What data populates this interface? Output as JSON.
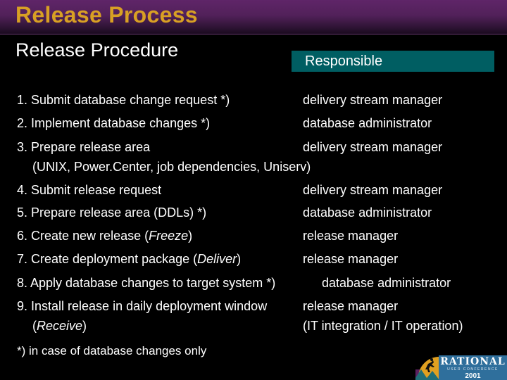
{
  "slide": {
    "title": "Release Process",
    "subtitle": "Release Procedure",
    "responsible_header": "Responsible",
    "rows": [
      {
        "step": "1. Submit database change request *)",
        "responsible": "delivery stream manager"
      },
      {
        "step": "2. Implement database changes *)",
        "responsible": "database administrator"
      },
      {
        "step": "3. Prepare release area",
        "step_detail": "(UNIX, Power.Center, job dependencies, Uniserv)",
        "responsible": "delivery stream manager"
      },
      {
        "step": "4. Submit release request",
        "responsible": "delivery stream manager"
      },
      {
        "step": "5. Prepare release area (DDLs) *)",
        "responsible": "database administrator"
      },
      {
        "step_prefix": "6. Create new release (",
        "step_italic": "Freeze",
        "step_suffix": ")",
        "responsible": "release manager"
      },
      {
        "step_prefix": "7. Create deployment package (",
        "step_italic": "Deliver",
        "step_suffix": ")",
        "responsible": "release manager"
      },
      {
        "step": "8. Apply database changes to target system *)",
        "responsible": "database administrator"
      },
      {
        "step": "9. Install release in daily deployment window",
        "detail_prefix": "(",
        "detail_italic": "Receive",
        "detail_suffix": ")",
        "responsible": "release manager",
        "responsible_detail": "(IT integration / IT operation)"
      }
    ],
    "footnote": "*) in case of database changes only"
  },
  "logo": {
    "line1": "RATIONAL",
    "line2": "USER CONFERENCE",
    "line3": "2001",
    "colors": {
      "sun": "#e0a020",
      "box": "#2f6f9c",
      "mountain": "#1e6e78",
      "ground": "#5a1f5e"
    }
  },
  "colors": {
    "title": "#d8a024",
    "header_top": "#5f2568",
    "responsible_box": "#005e62",
    "background": "#000000",
    "text": "#ffffff"
  }
}
